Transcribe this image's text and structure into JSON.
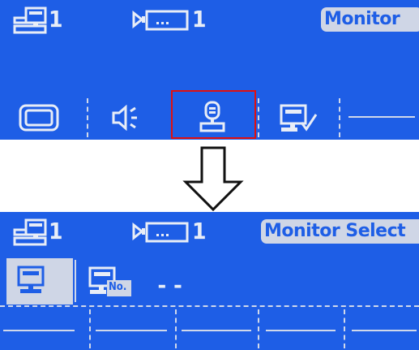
{
  "top_screen": {
    "pc_count": "1",
    "camera_count": "1",
    "mode_badge": "Monitor",
    "toolbar": {
      "items": [
        "screen-icon",
        "speaker-icon",
        "joystick-icon",
        "monitor-check-icon",
        "empty-slot"
      ],
      "empty_slot_text": "———",
      "highlighted_item": "joystick-icon"
    }
  },
  "bottom_screen": {
    "pc_count": "1",
    "camera_count": "1",
    "mode_badge": "Monitor Select",
    "monitor_number_label": "No.",
    "monitor_number_value": "--",
    "slots": [
      "———",
      "———",
      "———",
      "———",
      "———"
    ]
  },
  "colors": {
    "screen_bg": "#1e5ee6",
    "foreground": "#e8edf7",
    "badge_bg": "#cfd6e6",
    "highlight_border": "#e01010"
  }
}
